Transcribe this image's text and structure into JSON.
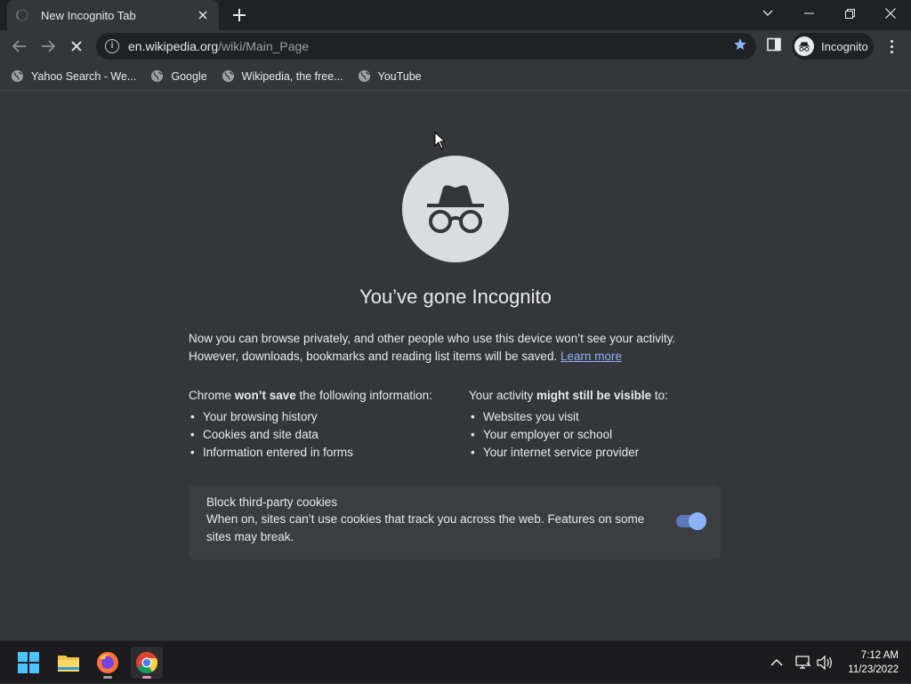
{
  "window": {
    "tab_title": "New Incognito Tab",
    "controls": [
      "chevron-down",
      "minimize",
      "restore",
      "close"
    ]
  },
  "toolbar": {
    "url_host": "en.wikipedia.org",
    "url_path": "/wiki/Main_Page",
    "profile_label": "Incognito"
  },
  "bookmarks": [
    {
      "label": "Yahoo Search - We..."
    },
    {
      "label": "Google"
    },
    {
      "label": "Wikipedia, the free..."
    },
    {
      "label": "YouTube"
    }
  ],
  "main": {
    "headline": "You’ve gone Incognito",
    "intro_line1": "Now you can browse privately, and other people who use this device won’t see your activity.",
    "intro_line2": "However, downloads, bookmarks and reading list items will be saved.",
    "learn_more": "Learn more",
    "left_title_pre": "Chrome ",
    "left_title_bold": "won’t save",
    "left_title_post": " the following information:",
    "left_items": [
      "Your browsing history",
      "Cookies and site data",
      "Information entered in forms"
    ],
    "right_title_pre": "Your activity ",
    "right_title_bold": "might still be visible",
    "right_title_post": " to:",
    "right_items": [
      "Websites you visit",
      "Your employer or school",
      "Your internet service provider"
    ],
    "cookie_title": "Block third-party cookies",
    "cookie_desc": "When on, sites can’t use cookies that track you across the web. Features on some sites may break.",
    "cookie_toggle_on": true
  },
  "taskbar": {
    "apps": [
      "windows-start",
      "file-explorer",
      "firefox",
      "chrome"
    ],
    "time": "7:12 AM",
    "date": "11/23/2022"
  },
  "colors": {
    "page_bg": "#35363a",
    "frame_bg": "#202124",
    "link": "#8ab4f8",
    "accent_star": "#8ab4f8"
  }
}
